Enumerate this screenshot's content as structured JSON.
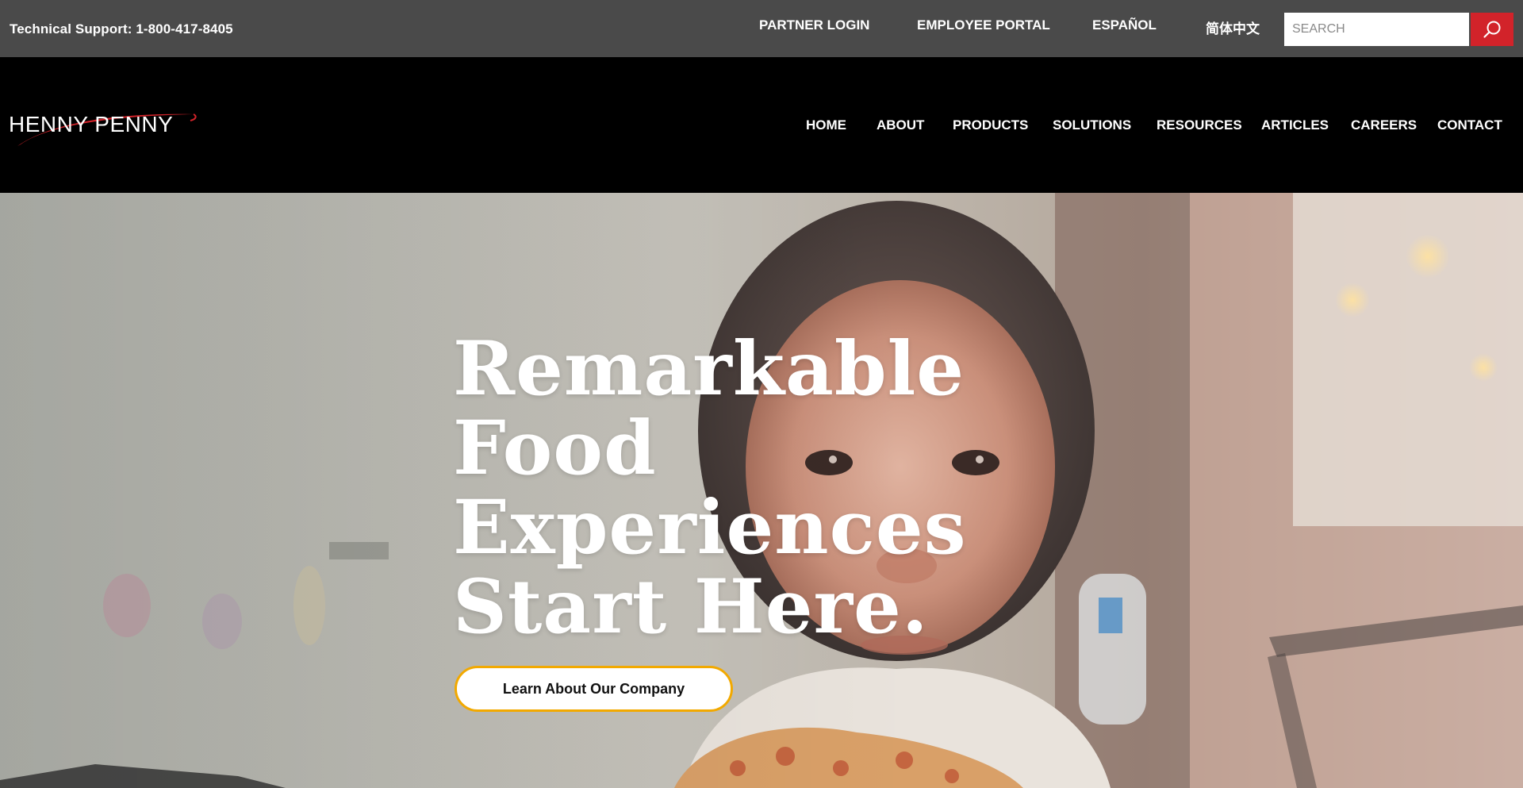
{
  "utility_bar": {
    "support_text": "Technical Support: 1-800-417-8405",
    "links": [
      {
        "label": "PARTNER LOGIN"
      },
      {
        "label": "EMPLOYEE PORTAL"
      },
      {
        "label": "ESPAÑOL"
      },
      {
        "label": "简体中文"
      }
    ],
    "search": {
      "placeholder": "SEARCH",
      "value": "",
      "button_icon": "search-icon"
    }
  },
  "header": {
    "logo_text": "HENNY PENNY",
    "nav": [
      {
        "label": "HOME"
      },
      {
        "label": "ABOUT"
      },
      {
        "label": "PRODUCTS"
      },
      {
        "label": "SOLUTIONS"
      },
      {
        "label": "RESOURCES"
      },
      {
        "label": "ARTICLES"
      },
      {
        "label": "CAREERS"
      },
      {
        "label": "CONTACT"
      }
    ]
  },
  "hero": {
    "headline_lines": [
      "Remarkable",
      "Food",
      "Experiences",
      "Start Here."
    ],
    "cta_label": "Learn About Our Company"
  },
  "colors": {
    "utility_bg": "#4a4a4a",
    "header_bg": "#000000",
    "brand_red": "#d2232a",
    "cta_border": "#f2a900"
  }
}
